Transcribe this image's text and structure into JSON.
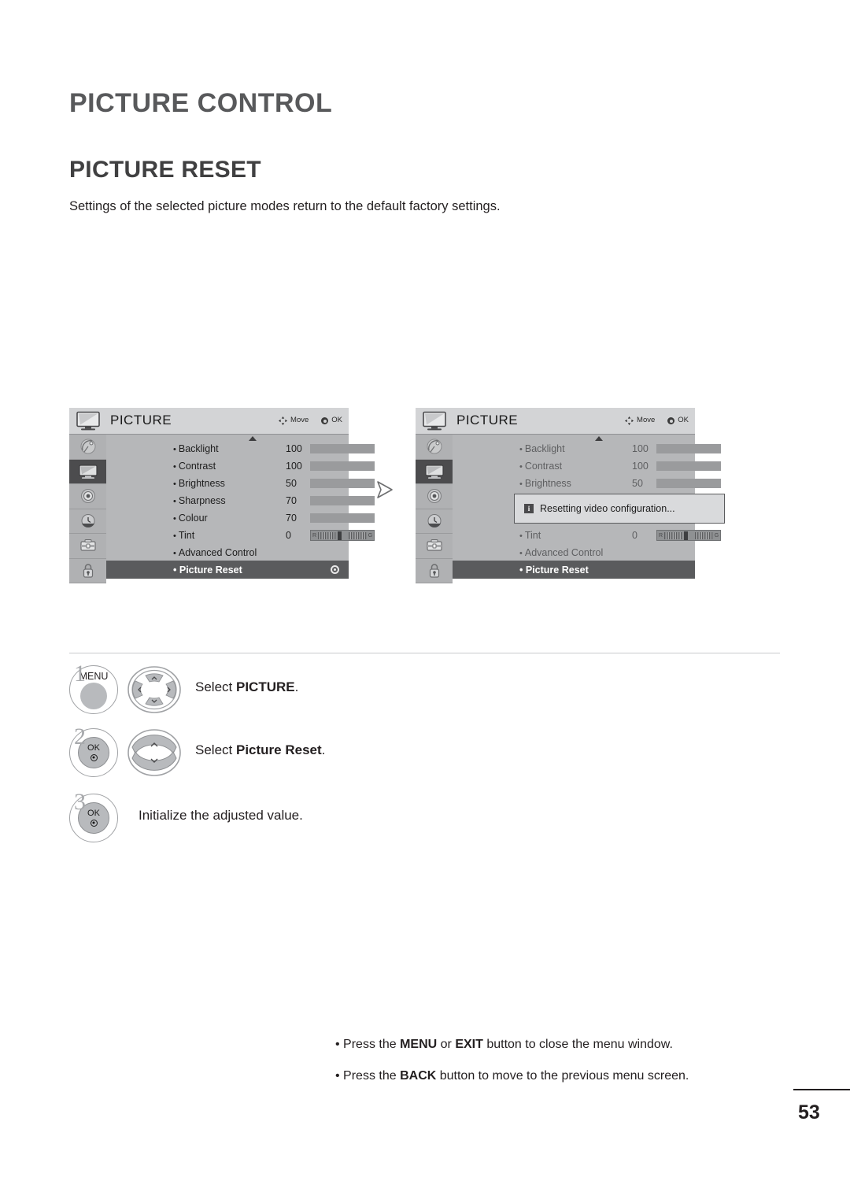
{
  "document": {
    "chapter_title": "PICTURE CONTROL",
    "section_title": "PICTURE RESET",
    "description": "Settings of the selected picture modes return to the default factory settings.",
    "page_number": "53"
  },
  "osd": {
    "title": "PICTURE",
    "hint_move": "Move",
    "hint_ok": "OK",
    "rail_icons": [
      "satellite-dish-icon",
      "picture-tv-icon",
      "audio-speaker-icon",
      "time-clock-icon",
      "option-toolbox-icon",
      "lock-padlock-icon"
    ],
    "selected_rail_index": 1,
    "rows": [
      {
        "label": "Backlight",
        "value": "100",
        "fill": 100,
        "type": "bar"
      },
      {
        "label": "Contrast",
        "value": "100",
        "fill": 100,
        "type": "bar"
      },
      {
        "label": "Brightness",
        "value": "50",
        "fill": 50,
        "type": "bar"
      },
      {
        "label": "Sharpness",
        "value": "70",
        "fill": 70,
        "type": "bar"
      },
      {
        "label": "Colour",
        "value": "70",
        "fill": 70,
        "type": "bar"
      },
      {
        "label": "Tint",
        "value": "0",
        "type": "tint",
        "tint_left": "R",
        "tint_right": "G"
      },
      {
        "label": "Advanced Control",
        "value": "",
        "type": "none"
      }
    ],
    "selected_row_label": "Picture Reset",
    "dialog": {
      "icon": "info-icon",
      "icon_glyph": "i",
      "message": "Resetting video configuration..."
    }
  },
  "flow": {
    "arrow_icon": "chevron-right-flow-icon"
  },
  "steps": [
    {
      "number": "1",
      "button_label": "MENU",
      "button_type": "menu-button",
      "wheel": "four-way-navigation-wheel",
      "text_prefix": "Select ",
      "text_bold": "PICTURE",
      "text_suffix": "."
    },
    {
      "number": "2",
      "button_label": "OK",
      "button_type": "ok-button",
      "wheel": "up-down-navigation-wheel",
      "text_prefix": "Select ",
      "text_bold": "Picture Reset",
      "text_suffix": "."
    },
    {
      "number": "3",
      "button_label": "OK",
      "button_type": "ok-button",
      "wheel": "",
      "text_prefix": "Initialize the adjusted value.",
      "text_bold": "",
      "text_suffix": ""
    }
  ],
  "notes": [
    {
      "p1": "• Press the ",
      "b1": "MENU",
      "p2": " or ",
      "b2": "EXIT",
      "p3": " button to close the menu window."
    },
    {
      "p1": "• Press the ",
      "b1": "BACK",
      "p2": "",
      "b2": "",
      "p3": " button to move to the previous menu screen."
    }
  ],
  "colors": {
    "heading": "#58595b",
    "body_text": "#231f20",
    "osd_background": "#b6b7b9",
    "osd_header": "#d3d4d6",
    "osd_selected_row": "#5a5b5d",
    "osd_bar_fill": "#4a4a4c",
    "osd_bar_track": "#9a9b9d"
  }
}
